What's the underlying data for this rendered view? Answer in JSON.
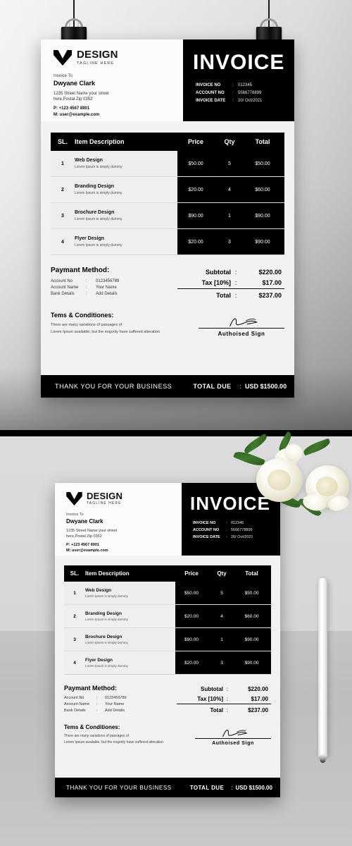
{
  "brand": {
    "logo_icon": "chevron-m-logo-icon",
    "name": "DESIGN",
    "tagline": "TAGLINE HERE"
  },
  "invoice_to": {
    "label": "Invoice To",
    "name": "Dwyane Clark",
    "address_line1": "1235 Street Name your street",
    "address_line2": "here,Postal Zip 0352",
    "phone": "P: +123 4567 8901",
    "email": "M: user@example.com"
  },
  "header": {
    "title": "INVOICE",
    "separator": ":",
    "meta": [
      {
        "label": "INVOICE NO",
        "value": "012345"
      },
      {
        "label": "ACCOUNT NO",
        "value": "5566778899"
      },
      {
        "label": "INVOICE DATE",
        "value": "20/ Oct/2021"
      }
    ]
  },
  "table": {
    "columns": {
      "sl": "SL.",
      "description": "Item Description",
      "price": "Price",
      "qty": "Qty",
      "total": "Total"
    },
    "rows": [
      {
        "sl": "1",
        "name": "Web Design",
        "sub": "Lorem Ipsum is simply dummy",
        "price": "$50.00",
        "qty": "5",
        "total": "$50.00"
      },
      {
        "sl": "2",
        "name": "Branding Design",
        "sub": "Lorem Ipsum is simply dummy",
        "price": "$20.00",
        "qty": "4",
        "total": "$60.00"
      },
      {
        "sl": "3",
        "name": "Brochure Design",
        "sub": "Lorem Ipsum is simply dummy",
        "price": "$90.00",
        "qty": "1",
        "total": "$90.00"
      },
      {
        "sl": "4",
        "name": "Flyer Design",
        "sub": "Lorem Ipsum is simply dummy",
        "price": "$20.00",
        "qty": "3",
        "total": "$90.00"
      }
    ]
  },
  "payment": {
    "title": "Paymant Method:",
    "separator": ":",
    "rows": [
      {
        "label": "Account No",
        "value": "0123456789"
      },
      {
        "label": "Account Name",
        "value": "Your Name"
      },
      {
        "label": "Bank Details",
        "value": "Add Details"
      }
    ]
  },
  "totals": {
    "separator": ":",
    "rows": [
      {
        "label": "Subtotal",
        "value": "$220.00"
      },
      {
        "label": "Tax [10%]",
        "value": "$17.00"
      },
      {
        "label": "Total",
        "value": "$237.00"
      }
    ]
  },
  "terms": {
    "title": "Tems & Conditiones:",
    "line1": "There are many variations of passages of",
    "line2": "Lorem Ipsum available, but the majority have suffered alteration"
  },
  "signature": {
    "label": "Authoised Sign",
    "icon": "signature-scribble-icon"
  },
  "footer": {
    "thanks": "THANK YOU FOR YOUR BUSINESS",
    "total_due_label": "TOTAL DUE",
    "separator": ":",
    "total_due_value": "USD $1500.00"
  },
  "props": {
    "clip_left_icon": "binder-clip-icon",
    "clip_right_icon": "binder-clip-icon",
    "pencil_icon": "white-pencil-icon",
    "rose_icon": "white-rose-icon"
  },
  "colors": {
    "ink": "#000000",
    "paper": "#f2f2f2",
    "paper_header": "#fbfbfb",
    "row": "#efefef",
    "muted": "#555555"
  }
}
